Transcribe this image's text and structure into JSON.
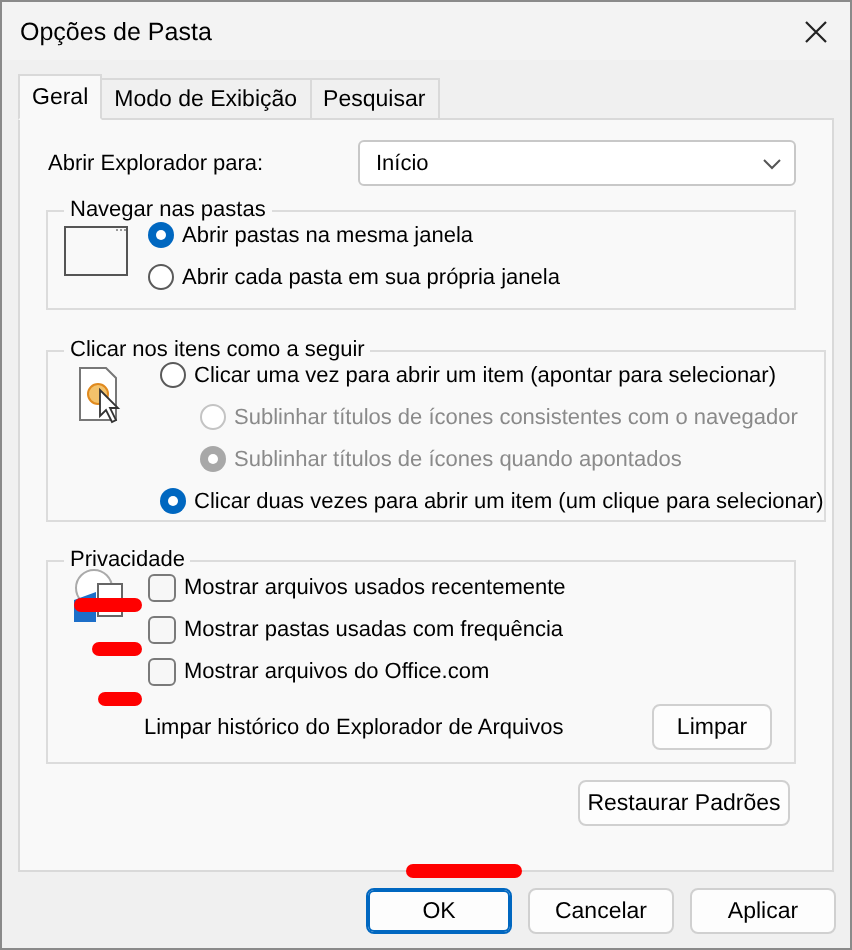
{
  "window": {
    "title": "Opções de Pasta"
  },
  "tabs": [
    {
      "label": "Geral",
      "selected": true
    },
    {
      "label": "Modo de Exibição",
      "selected": false
    },
    {
      "label": "Pesquisar",
      "selected": false
    }
  ],
  "open_explorer": {
    "label": "Abrir Explorador para:",
    "value": "Início"
  },
  "navigate": {
    "title": "Navegar nas pastas",
    "options": [
      {
        "label": "Abrir pastas na mesma janela",
        "selected": true
      },
      {
        "label": "Abrir cada pasta em sua própria janela",
        "selected": false
      }
    ]
  },
  "click_items": {
    "title": "Clicar nos itens como a seguir",
    "options": [
      {
        "label": "Clicar uma vez para abrir um item (apontar para selecionar)",
        "selected": false,
        "disabled": false,
        "children": [
          {
            "label": "Sublinhar títulos de ícones consistentes com o navegador",
            "selected": false,
            "disabled": true
          },
          {
            "label": "Sublinhar títulos de ícones quando apontados",
            "selected": true,
            "disabled": true
          }
        ]
      },
      {
        "label": "Clicar duas vezes para abrir um item (um clique para selecionar)",
        "selected": true,
        "disabled": false
      }
    ]
  },
  "privacy": {
    "title": "Privacidade",
    "options": [
      {
        "label": "Mostrar arquivos usados recentemente",
        "checked": false
      },
      {
        "label": "Mostrar pastas usadas com frequência",
        "checked": false
      },
      {
        "label": "Mostrar arquivos do Office.com",
        "checked": false
      }
    ],
    "clear_label": "Limpar histórico do Explorador de Arquivos",
    "clear_button": "Limpar"
  },
  "restore_button": "Restaurar Padrões",
  "buttons": [
    {
      "label": "OK",
      "default": true
    },
    {
      "label": "Cancelar",
      "default": false
    },
    {
      "label": "Aplicar",
      "default": false
    }
  ]
}
